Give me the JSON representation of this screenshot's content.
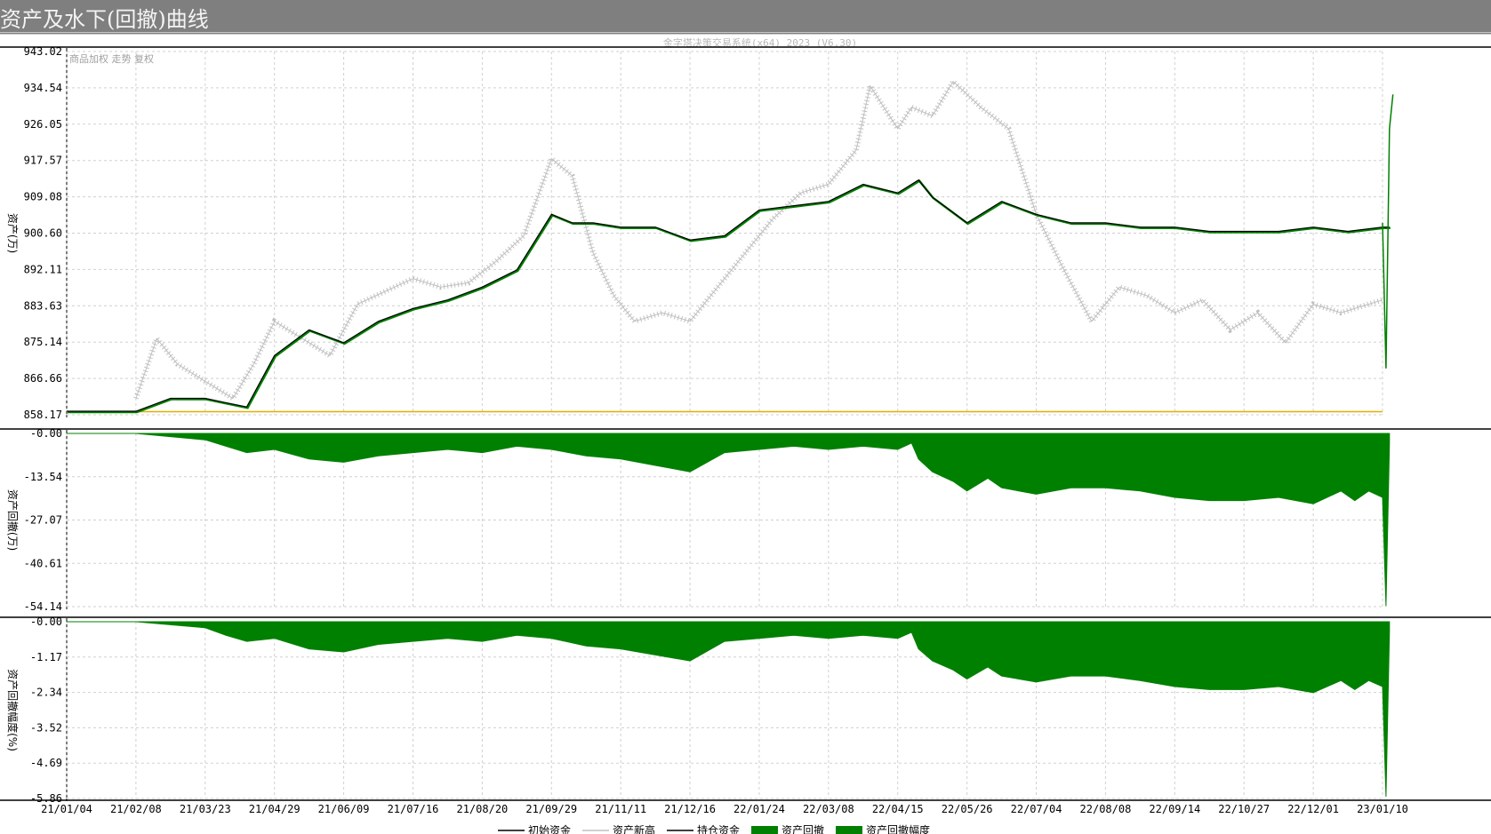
{
  "window": {
    "title": "资产及水下(回撤)曲线"
  },
  "watermark": "金字塔决策交易系统(x64) 2023 (V6.30)",
  "top_left_tags": "商品加权 走势 复权",
  "colors": {
    "equity": "#000000",
    "equity_alt": "#008000",
    "underlying": "#c0c0c0",
    "initial_line": "#e0b000",
    "drawdown_fill": "#008000"
  },
  "chart_data": [
    {
      "type": "line",
      "ylabel": "资产(万)",
      "y_ticks": [
        "943.02",
        "934.54",
        "926.05",
        "917.57",
        "909.08",
        "900.60",
        "892.11",
        "883.63",
        "875.14",
        "866.66",
        "858.17"
      ],
      "ylim": [
        858.17,
        943.02
      ],
      "x_ticks": [
        "21/01/04",
        "21/02/08",
        "21/03/23",
        "21/04/29",
        "21/06/09",
        "21/07/16",
        "21/08/20",
        "21/09/29",
        "21/11/11",
        "21/12/16",
        "22/01/24",
        "22/03/08",
        "22/04/15",
        "22/05/26",
        "22/07/04",
        "22/08/08",
        "22/09/14",
        "22/10/27",
        "22/12/01",
        "23/01/10"
      ],
      "grid": true,
      "series": [
        {
          "legend": "初始资金",
          "values": [
            858.9,
            858.9
          ]
        },
        {
          "legend": "资产",
          "x_idx": [
            0,
            1,
            1.5,
            2,
            2.3,
            2.6,
            3,
            3.5,
            4,
            4.5,
            5,
            5.5,
            6,
            6.5,
            7,
            7.3,
            7.6,
            8,
            8.5,
            9,
            9.5,
            10,
            10.5,
            11,
            11.5,
            12,
            12.3,
            12.5,
            13,
            13.5,
            14,
            14.5,
            15,
            15.5,
            16,
            16.5,
            17,
            17.5,
            18,
            18.5,
            19,
            19.1
          ],
          "values": [
            859,
            859,
            862,
            862,
            861,
            860,
            872,
            878,
            875,
            880,
            883,
            885,
            888,
            892,
            905,
            903,
            903,
            902,
            902,
            899,
            900,
            906,
            907,
            908,
            912,
            910,
            913,
            909,
            903,
            908,
            905,
            903,
            903,
            902,
            902,
            901,
            901,
            901,
            902,
            901,
            902,
            902
          ]
        },
        {
          "legend": "商品加权",
          "x_idx": [
            1,
            1.3,
            1.6,
            2,
            2.4,
            2.7,
            3,
            3.4,
            3.8,
            4.2,
            4.6,
            5,
            5.4,
            5.8,
            6.2,
            6.6,
            7,
            7.3,
            7.6,
            7.9,
            8.2,
            8.6,
            9,
            9.4,
            9.8,
            10.2,
            10.6,
            11,
            11.4,
            11.6,
            12,
            12.2,
            12.5,
            12.8,
            13.2,
            13.6,
            14,
            14.4,
            14.8,
            15.2,
            15.6,
            16,
            16.4,
            16.8,
            17.2,
            17.6,
            18,
            18.4,
            18.8,
            19
          ],
          "values": [
            862,
            876,
            870,
            866,
            862,
            870,
            880,
            876,
            872,
            884,
            887,
            890,
            888,
            889,
            894,
            900,
            918,
            914,
            896,
            886,
            880,
            882,
            880,
            888,
            896,
            904,
            910,
            912,
            920,
            935,
            925,
            930,
            928,
            936,
            930,
            925,
            905,
            892,
            880,
            888,
            886,
            882,
            885,
            878,
            882,
            875,
            884,
            882,
            884,
            885
          ]
        },
        {
          "legend": "资产新高",
          "x_idx": [
            19.0,
            19.05,
            19.1,
            19.15
          ],
          "values": [
            903,
            869,
            925,
            933
          ]
        }
      ]
    },
    {
      "type": "area",
      "ylabel": "资产回撤(万)",
      "y_ticks": [
        "-0.00",
        "-13.54",
        "-27.07",
        "-40.61",
        "-54.14"
      ],
      "ylim": [
        -54.14,
        0
      ],
      "series": [
        {
          "legend": "资产回撤",
          "x_idx": [
            0,
            1,
            1.5,
            2,
            2.3,
            2.6,
            3,
            3.5,
            4,
            4.5,
            5,
            5.5,
            6,
            6.5,
            7,
            7.5,
            8,
            8.5,
            9,
            9.5,
            10,
            10.5,
            11,
            11.5,
            12,
            12.2,
            12.3,
            12.5,
            12.8,
            13,
            13.3,
            13.5,
            14,
            14.5,
            15,
            15.5,
            16,
            16.5,
            17,
            17.5,
            18,
            18.4,
            18.6,
            18.8,
            19,
            19.05,
            19.1
          ],
          "values": [
            0,
            0,
            -1,
            -2,
            -4,
            -6,
            -5,
            -8,
            -9,
            -7,
            -6,
            -5,
            -6,
            -4,
            -5,
            -7,
            -8,
            -10,
            -12,
            -6,
            -5,
            -4,
            -5,
            -4,
            -5,
            -3,
            -8,
            -12,
            -15,
            -18,
            -14,
            -17,
            -19,
            -17,
            -17,
            -18,
            -20,
            -21,
            -21,
            -20,
            -22,
            -18,
            -21,
            -18,
            -20,
            -54,
            -3
          ]
        }
      ]
    },
    {
      "type": "area",
      "ylabel": "资产回撤幅度(%)",
      "y_ticks": [
        "-0.00",
        "-1.17",
        "-2.34",
        "-3.52",
        "-4.69",
        "-5.86"
      ],
      "ylim": [
        -5.86,
        0
      ],
      "series": [
        {
          "legend": "资产回撤幅度",
          "x_idx": [
            0,
            1,
            1.5,
            2,
            2.3,
            2.6,
            3,
            3.5,
            4,
            4.5,
            5,
            5.5,
            6,
            6.5,
            7,
            7.5,
            8,
            8.5,
            9,
            9.5,
            10,
            10.5,
            11,
            11.5,
            12,
            12.2,
            12.3,
            12.5,
            12.8,
            13,
            13.3,
            13.5,
            14,
            14.5,
            15,
            15.5,
            16,
            16.5,
            17,
            17.5,
            18,
            18.4,
            18.6,
            18.8,
            19,
            19.05,
            19.1
          ],
          "values": [
            0,
            0,
            -0.1,
            -0.2,
            -0.45,
            -0.65,
            -0.55,
            -0.9,
            -1.0,
            -0.75,
            -0.65,
            -0.55,
            -0.65,
            -0.45,
            -0.55,
            -0.8,
            -0.9,
            -1.1,
            -1.3,
            -0.65,
            -0.55,
            -0.45,
            -0.55,
            -0.45,
            -0.55,
            -0.35,
            -0.9,
            -1.3,
            -1.6,
            -1.9,
            -1.5,
            -1.8,
            -2.0,
            -1.8,
            -1.8,
            -1.95,
            -2.15,
            -2.25,
            -2.25,
            -2.15,
            -2.35,
            -1.95,
            -2.25,
            -1.95,
            -2.15,
            -5.8,
            -0.3
          ]
        }
      ]
    }
  ],
  "legend_items": [
    {
      "label": "初始资金"
    },
    {
      "label": "资产新高"
    },
    {
      "label": "持仓资金"
    },
    {
      "label": "资产回撤"
    },
    {
      "label": "资产回撤幅度"
    }
  ]
}
